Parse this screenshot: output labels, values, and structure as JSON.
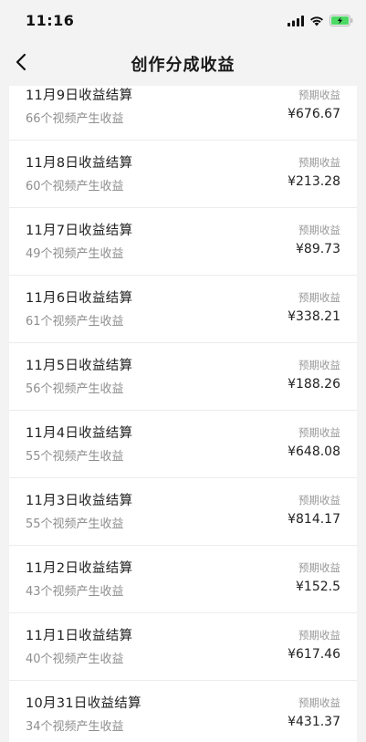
{
  "status_bar": {
    "time": "11:16",
    "icons": [
      "signal-icon",
      "wifi-icon",
      "battery-charging-icon"
    ],
    "battery_color": "#4cd964"
  },
  "nav": {
    "back_icon": "chevron-left-icon",
    "title": "创作分成收益"
  },
  "rows": [
    {
      "title": "11月9日收益结算",
      "subtitle": "66个视频产生收益",
      "label": "预期收益",
      "amount": "¥676.67"
    },
    {
      "title": "11月8日收益结算",
      "subtitle": "60个视频产生收益",
      "label": "预期收益",
      "amount": "¥213.28"
    },
    {
      "title": "11月7日收益结算",
      "subtitle": "49个视频产生收益",
      "label": "预期收益",
      "amount": "¥89.73"
    },
    {
      "title": "11月6日收益结算",
      "subtitle": "61个视频产生收益",
      "label": "预期收益",
      "amount": "¥338.21"
    },
    {
      "title": "11月5日收益结算",
      "subtitle": "56个视频产生收益",
      "label": "预期收益",
      "amount": "¥188.26"
    },
    {
      "title": "11月4日收益结算",
      "subtitle": "55个视频产生收益",
      "label": "预期收益",
      "amount": "¥648.08"
    },
    {
      "title": "11月3日收益结算",
      "subtitle": "55个视频产生收益",
      "label": "预期收益",
      "amount": "¥814.17"
    },
    {
      "title": "11月2日收益结算",
      "subtitle": "43个视频产生收益",
      "label": "预期收益",
      "amount": "¥152.5"
    },
    {
      "title": "11月1日收益结算",
      "subtitle": "40个视频产生收益",
      "label": "预期收益",
      "amount": "¥617.46"
    },
    {
      "title": "10月31日收益结算",
      "subtitle": "34个视频产生收益",
      "label": "预期收益",
      "amount": "¥431.37"
    }
  ]
}
